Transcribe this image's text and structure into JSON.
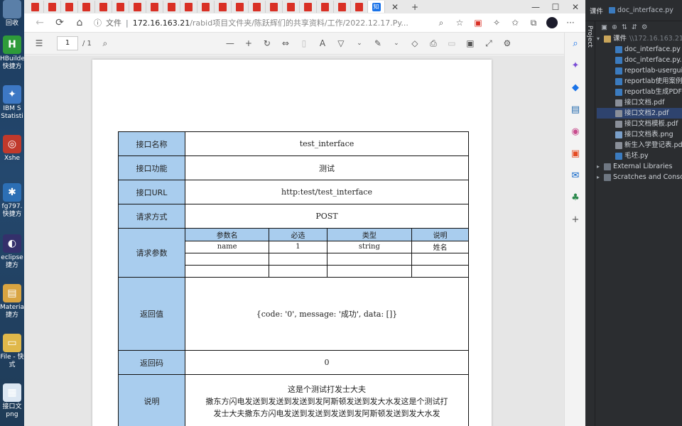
{
  "desktop": {
    "items": [
      {
        "label": "回收",
        "color": "#5a7fa8"
      },
      {
        "label": "HBuilder 快捷方",
        "color": "#2e9b3a",
        "glyph": "H"
      },
      {
        "label": "IBM S Statisti",
        "color": "#3d78c4",
        "glyph": "✦"
      },
      {
        "label": "Xshe",
        "color": "#c0392b",
        "glyph": "◎"
      },
      {
        "label": "fg797. 快捷方",
        "color": "#2c6fb5",
        "glyph": "✱"
      },
      {
        "label": "eclipse 捷方",
        "color": "#34306b",
        "glyph": "◐"
      },
      {
        "label": "Materia 捷方",
        "color": "#d9a441",
        "glyph": "▤"
      },
      {
        "label": "File - 快 式",
        "color": "#e0b84a",
        "glyph": "▭"
      },
      {
        "label": "接口文 png",
        "color": "#dbe6f2",
        "glyph": "▦"
      }
    ]
  },
  "browser": {
    "tab_count_pdf": 20,
    "address": {
      "secure_label": "文件",
      "host": "172.16.163.21",
      "path": "/rabid项目文件夹/陈跃辉们的共享资料/工作/2022.12.17.Py..."
    },
    "pdf_toolbar": {
      "page_current": "1",
      "page_total": "/ 1"
    }
  },
  "document": {
    "rows": [
      {
        "label": "接口名称",
        "value": "test_interface"
      },
      {
        "label": "接口功能",
        "value": "测试"
      },
      {
        "label": "接口URL",
        "value": "http:test/test_interface"
      },
      {
        "label": "请求方式",
        "value": "POST"
      }
    ],
    "params": {
      "label": "请求参数",
      "headers": [
        "参数名",
        "必选",
        "类型",
        "说明"
      ],
      "rows": [
        [
          "name",
          "1",
          "string",
          "姓名"
        ],
        [
          "",
          "",
          "",
          ""
        ],
        [
          "",
          "",
          "",
          ""
        ]
      ]
    },
    "return_value": {
      "label": "返回值",
      "value": "{code: '0', message: '成功', data: []}"
    },
    "return_code": {
      "label": "返回码",
      "value": "0"
    },
    "description": {
      "label": "说明",
      "lines": [
        "这是个测试打发士大夫",
        "撒东方闪电发送到发送到发送到发阿斯顿发送到发大水发这是个测试打",
        "发士大夫撒东方闪电发送到发送到发送到发阿斯顿发送到发大水发"
      ]
    }
  },
  "ide": {
    "tab_project": "课件",
    "tab_file": "doc_interface.py",
    "side_label": "Project",
    "root": "课件",
    "root_path": "\\\\172.16.163.21",
    "files": [
      {
        "name": "doc_interface.py",
        "kind": "py"
      },
      {
        "name": "doc_interface.py.p",
        "kind": "py"
      },
      {
        "name": "reportlab-usergui",
        "kind": "py"
      },
      {
        "name": "reportlab使用案例",
        "kind": "py"
      },
      {
        "name": "reportlab生成PDF",
        "kind": "py"
      },
      {
        "name": "接口文档.pdf",
        "kind": "pdf"
      },
      {
        "name": "接口文档2.pdf",
        "kind": "pdf",
        "selected": true
      },
      {
        "name": "接口文档模板.pdf",
        "kind": "pdf"
      },
      {
        "name": "接口文档表.png",
        "kind": "png"
      },
      {
        "name": "新生入学登记表.pd",
        "kind": "pdf"
      },
      {
        "name": "毛坯.py",
        "kind": "py"
      }
    ],
    "extra": [
      {
        "name": "External Libraries"
      },
      {
        "name": "Scratches and Conso"
      }
    ]
  }
}
